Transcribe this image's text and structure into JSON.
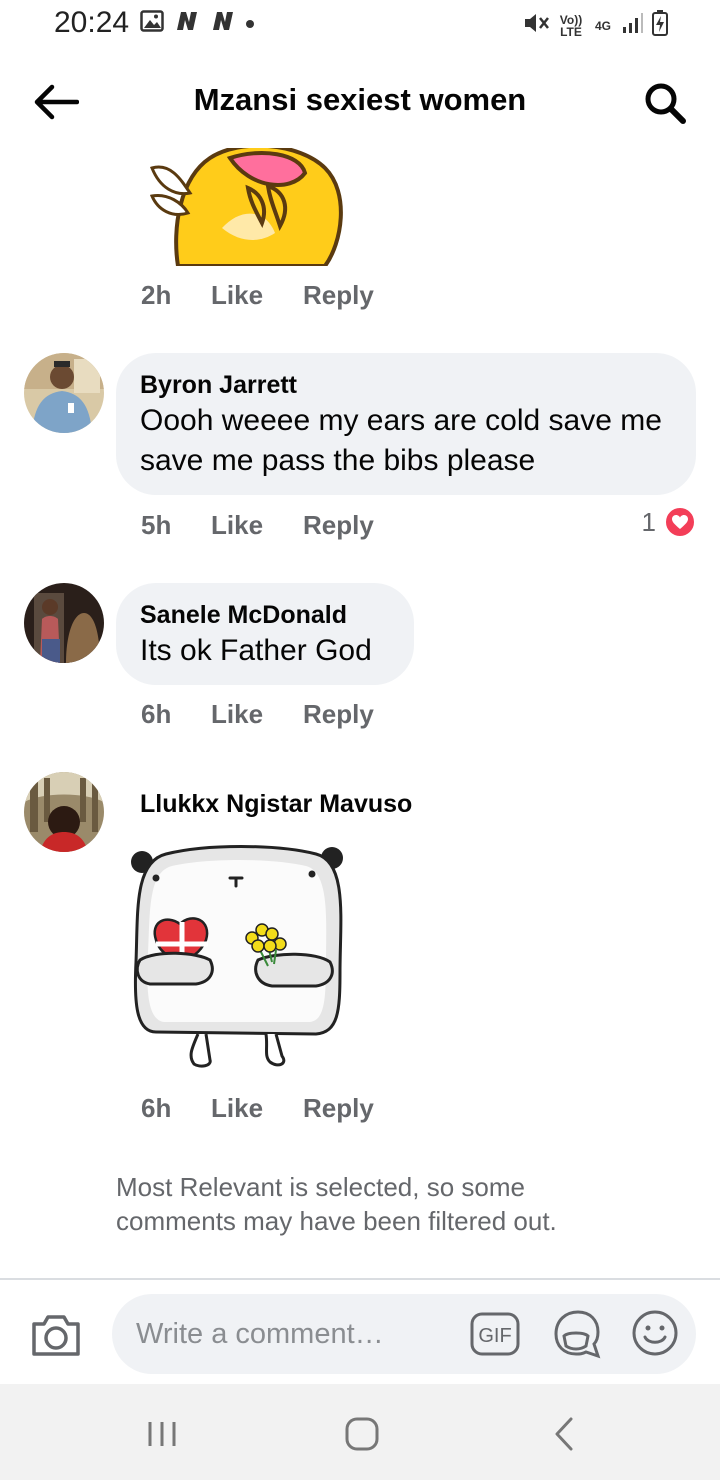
{
  "status_bar": {
    "time": "20:24",
    "network_volte": "Vo)) LTE",
    "network_type": "4G"
  },
  "header": {
    "title": "Mzansi sexiest women"
  },
  "comments": [
    {
      "time": "2h",
      "like_label": "Like",
      "reply_label": "Reply",
      "sticker": "bird-sticker"
    },
    {
      "author": "Byron Jarrett",
      "text": "Oooh weeee my ears are cold save me save me pass the bibs please",
      "time": "5h",
      "like_label": "Like",
      "reply_label": "Reply",
      "reaction_count": "1"
    },
    {
      "author": "Sanele McDonald",
      "text": "Its ok Father God",
      "time": "6h",
      "like_label": "Like",
      "reply_label": "Reply"
    },
    {
      "author": "Llukkx Ngistar Mavuso",
      "time": "6h",
      "like_label": "Like",
      "reply_label": "Reply",
      "sticker": "bear-with-flowers-sticker"
    }
  ],
  "filter_note": "Most Relevant is selected, so some comments may have been filtered out.",
  "composer": {
    "placeholder": "Write a comment…",
    "gif_label": "GIF"
  },
  "colors": {
    "text_primary": "#050505",
    "text_secondary": "#65676b",
    "bubble_bg": "#f0f2f5",
    "love_reaction": "#f33e58"
  }
}
